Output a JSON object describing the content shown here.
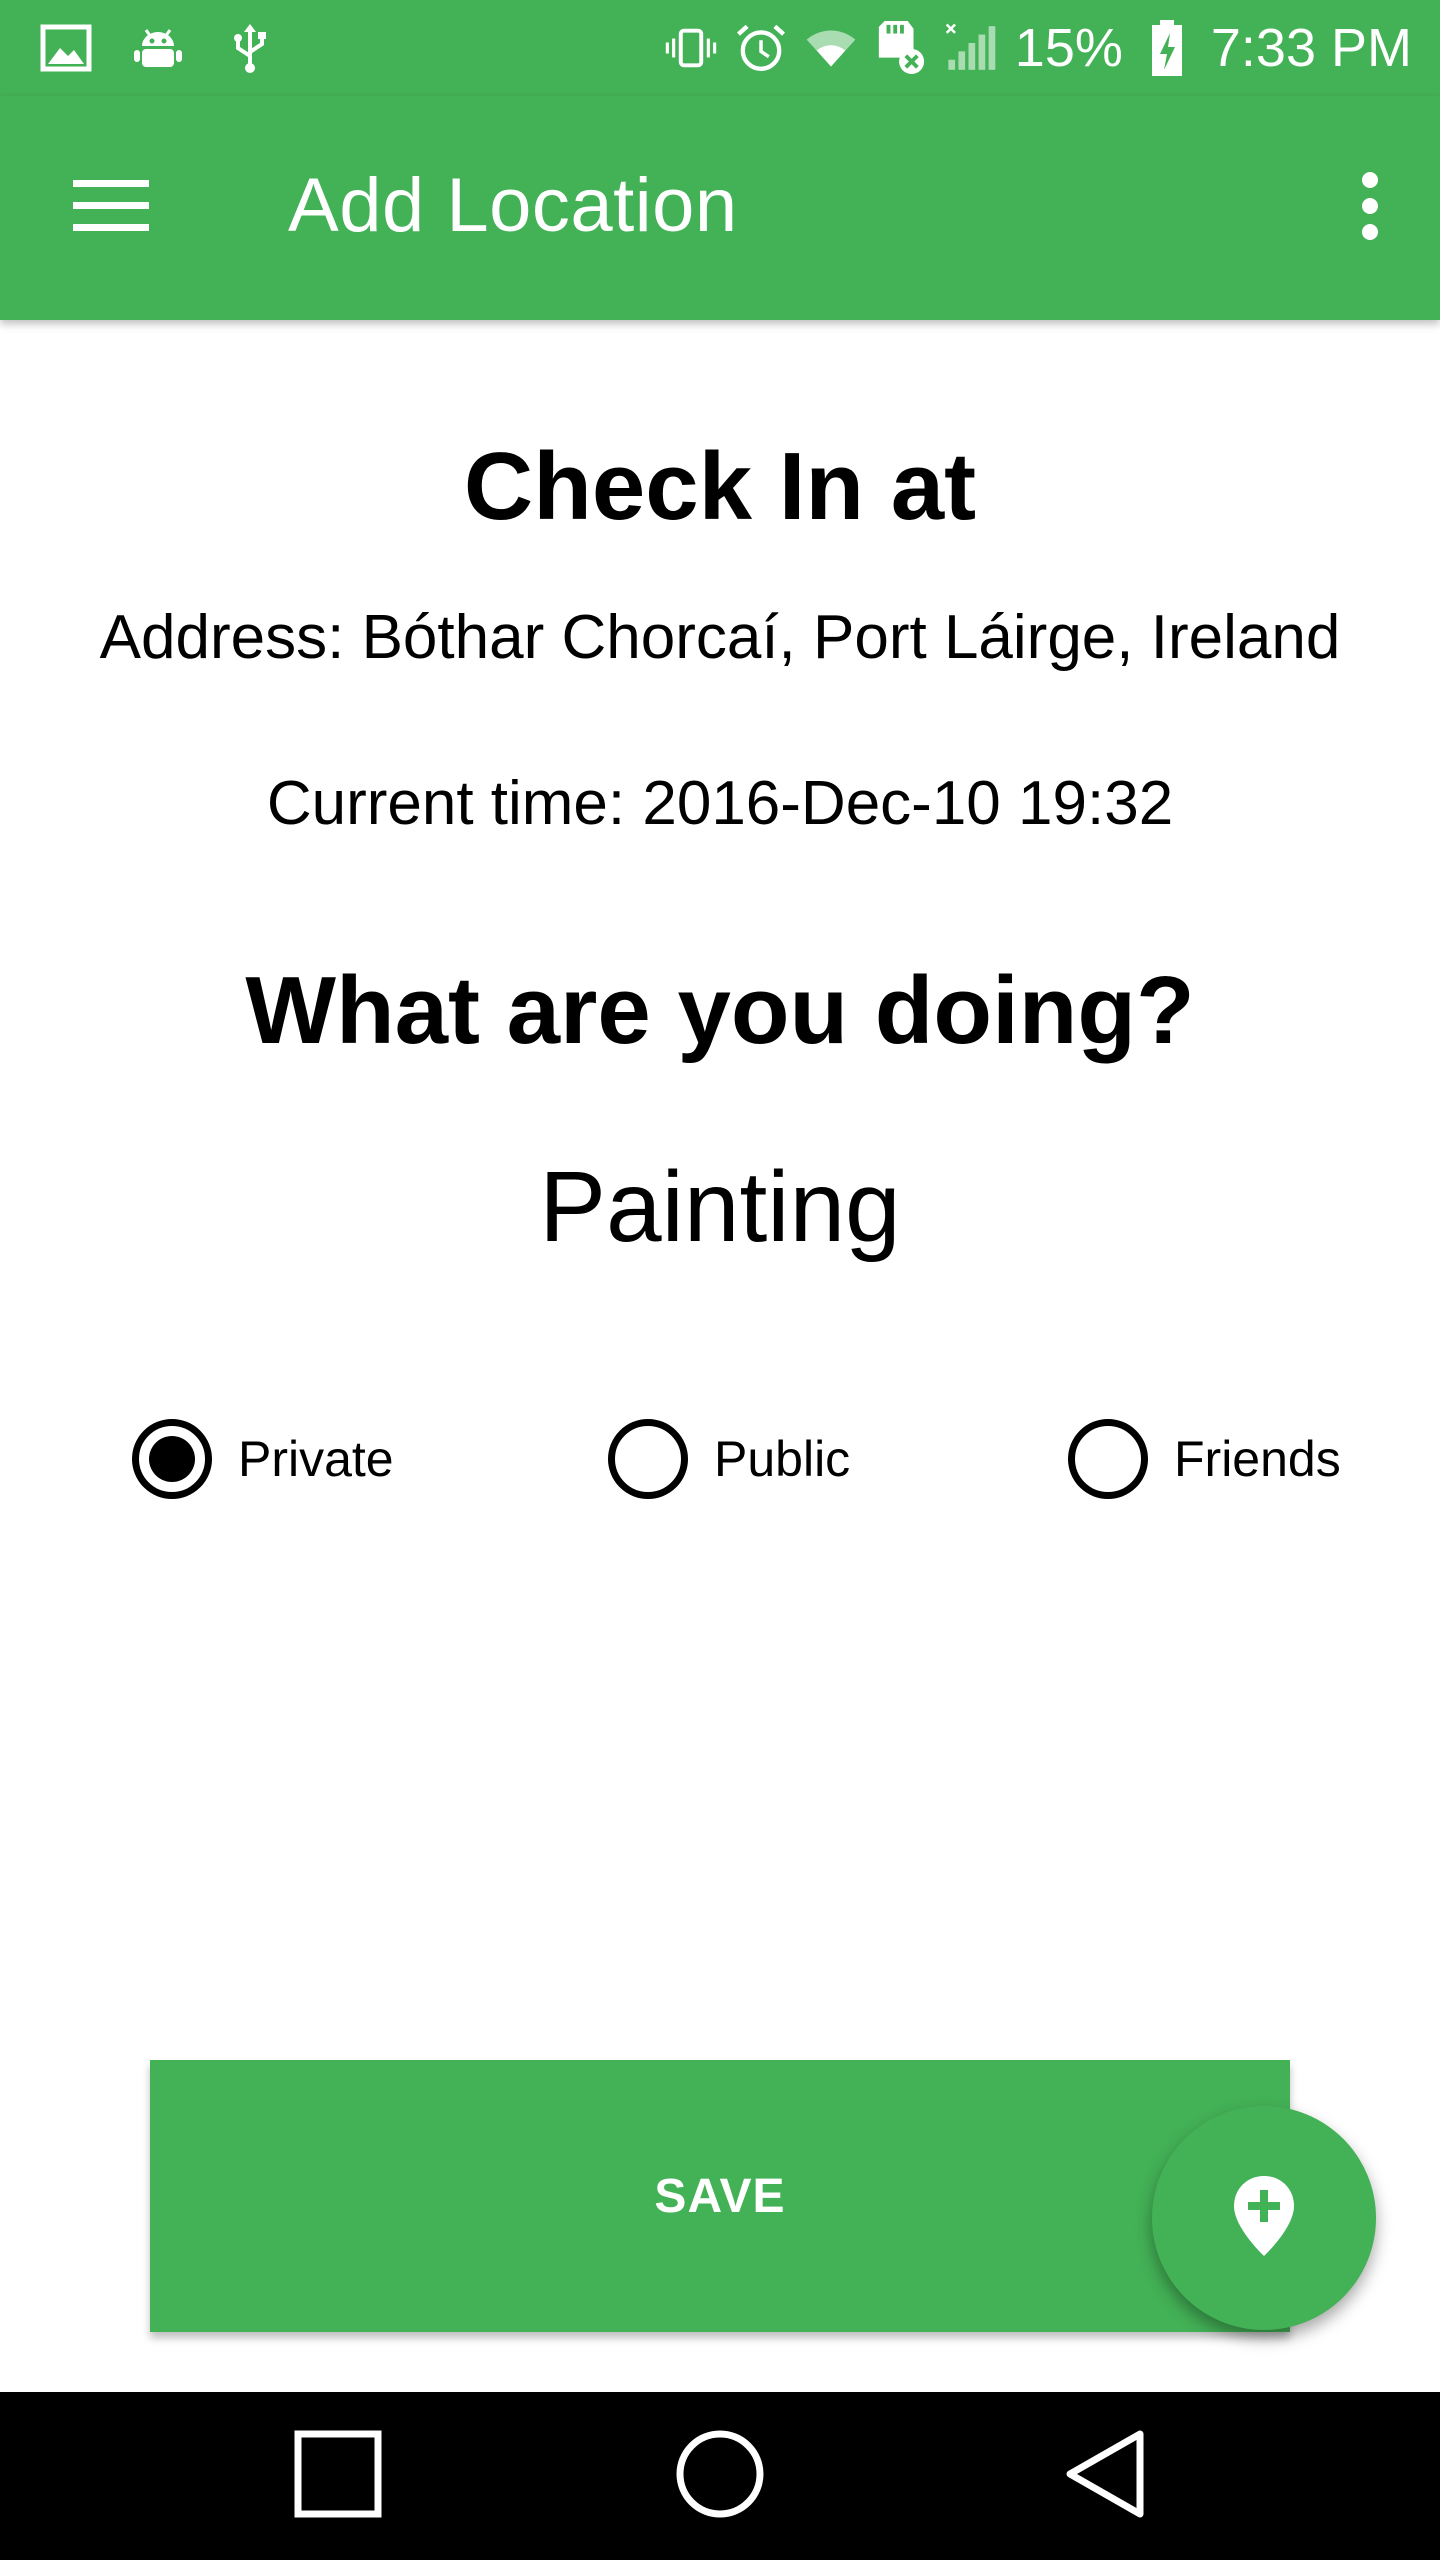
{
  "status_bar": {
    "icons": [
      "gallery-icon",
      "android-debug-icon",
      "usb-icon",
      "vibrate-icon",
      "alarm-icon",
      "wifi-icon",
      "sd-card-error-icon",
      "cell-signal-icon",
      "battery-charging-icon"
    ],
    "battery_percent": "15%",
    "time": "7:33 PM"
  },
  "app_bar": {
    "title": "Add Location",
    "menu_icon": "hamburger-menu-icon",
    "overflow_icon": "more-vert-icon"
  },
  "content": {
    "heading": "Check In at",
    "address": "Address: Bóthar Chorcaí, Port Láirge, Ireland",
    "current_time": "Current time: 2016-Dec-10 19:32",
    "question": "What are you doing?",
    "activity": "Painting"
  },
  "visibility": {
    "selected": "Private",
    "options": [
      {
        "label": "Private",
        "checked": true
      },
      {
        "label": "Public",
        "checked": false
      },
      {
        "label": "Friends",
        "checked": false
      }
    ]
  },
  "actions": {
    "save_label": "SAVE",
    "fab_icon": "add-location-icon"
  },
  "nav_bar": {
    "icons": [
      "recent-apps-icon",
      "home-icon",
      "back-icon"
    ]
  },
  "colors": {
    "primary": "#43b156",
    "text": "#000000",
    "on_primary": "#ffffff",
    "nav_bar": "#000000"
  }
}
